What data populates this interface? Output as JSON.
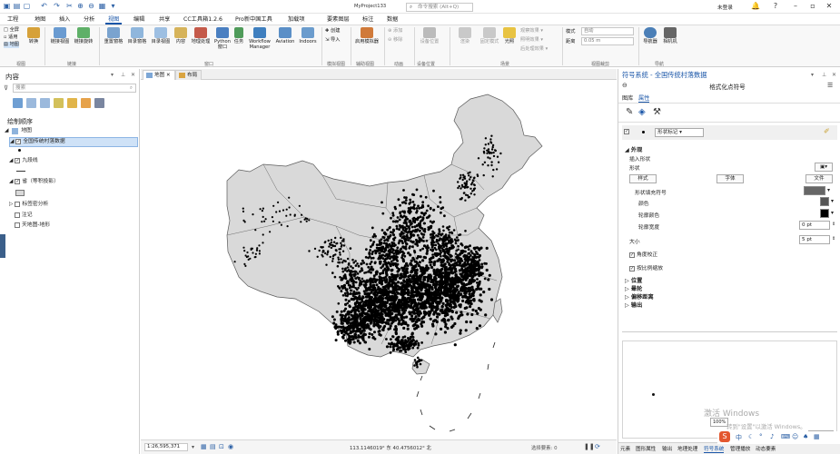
{
  "app": {
    "project": "MyProject133",
    "search_placeholder": "命令搜索 (Alt+Q)",
    "user": "未登录",
    "qa_icons": [
      "save-icon",
      "open-icon",
      "new-icon",
      "undo-icon",
      "redo-icon",
      "cut-icon",
      "copy-icon",
      "paste-icon",
      "zoom-in-icon",
      "zoom-out-icon",
      "grid-icon",
      "dropdown-icon"
    ]
  },
  "tabs": [
    "工程",
    "地图",
    "插入",
    "分析",
    "视图",
    "编辑",
    "共享",
    "CC工具箱1.2.6",
    "Pro新中国工具",
    "加载项",
    "要素图层",
    "标注",
    "数据"
  ],
  "active_tab": "视图",
  "ribbon": {
    "small_left": [
      "全屏",
      "适用",
      "地图"
    ],
    "convert": "转换",
    "buttons": [
      "链接视图",
      "链接旋转",
      "重置窗格",
      "目录窗格",
      "目录视图",
      "内容",
      "地理处理",
      "Python窗口",
      "Workflow Manager",
      "Aviation",
      "Indoors"
    ],
    "view_small": [
      "创建",
      "导入"
    ],
    "aux": "启用模拟器",
    "add_small": [
      "添加",
      "移除"
    ],
    "device": "设备位置",
    "render_small": [
      "渲染",
      "固定模式",
      "暗视角"
    ],
    "light_small": [
      "观察效果",
      "照明效果",
      "后处理效果"
    ],
    "shadow": "光照",
    "mode_labels": [
      "模式",
      "距离"
    ],
    "mode_values": [
      "自动",
      "0.05 m"
    ],
    "nav": [
      "导航器",
      "相机机"
    ],
    "groups": [
      "视图",
      "链接",
      "窗口",
      "模拟视图",
      "辅助视图",
      "动画",
      "设备位置",
      "场景",
      "视图裁剪",
      "导航"
    ]
  },
  "contents": {
    "title": "内容",
    "search_placeholder": "搜索",
    "draw_order": "绘制顺序",
    "items": [
      {
        "label": "地图",
        "checked": false,
        "level": 0
      },
      {
        "label": "全国传统村落数据",
        "checked": true,
        "level": 1
      },
      {
        "label": "九段线",
        "checked": true,
        "level": 1
      },
      {
        "label": "省（等积投影）",
        "checked": true,
        "level": 1
      },
      {
        "label": "标签密分析",
        "checked": false,
        "level": 1
      },
      {
        "label": "注记",
        "checked": false,
        "level": 1
      },
      {
        "label": "天地图-地形",
        "checked": false,
        "level": 1
      }
    ]
  },
  "map": {
    "tabs": [
      "地图",
      "布局"
    ],
    "scale": "1:26,595,371",
    "coords": "113.1146019° 东 40.4756012° 北",
    "status": "选择要素: 0"
  },
  "symbology": {
    "panel_title": "符号系统 - 全国传统村落数据",
    "subtitle": "格式化点符号",
    "tabs": [
      "图库",
      "属性"
    ],
    "shape_marker": "形状标记",
    "sections": {
      "appearance": "外观",
      "position": "位置",
      "halo": "晕轮",
      "offset": "偏移距离",
      "output": "输出"
    },
    "insert_shape": "插入形状",
    "shape": "形状",
    "buttons": [
      "样式",
      "字体",
      "文件"
    ],
    "shape_fill": "形状填充符号",
    "color": "颜色",
    "outline_color": "轮廓颜色",
    "outline_width": "轮廓宽度",
    "outline_width_value": "0 pt",
    "size": "大小",
    "size_value": "5 pt",
    "checks": [
      "角度校正",
      "按比例缩放"
    ],
    "zoom": "100%",
    "apply": "应用"
  },
  "bottom_tabs": [
    "元素",
    "图形属性",
    "输出",
    "地理处理",
    "符号系统",
    "管理播放",
    "动态要素"
  ],
  "watermark": [
    "激活 Windows",
    "转到\"设置\"以激活 Windows。"
  ],
  "colors": {
    "accent": "#1a56a8",
    "land": "#d9d9d9",
    "dots": "#000000"
  }
}
